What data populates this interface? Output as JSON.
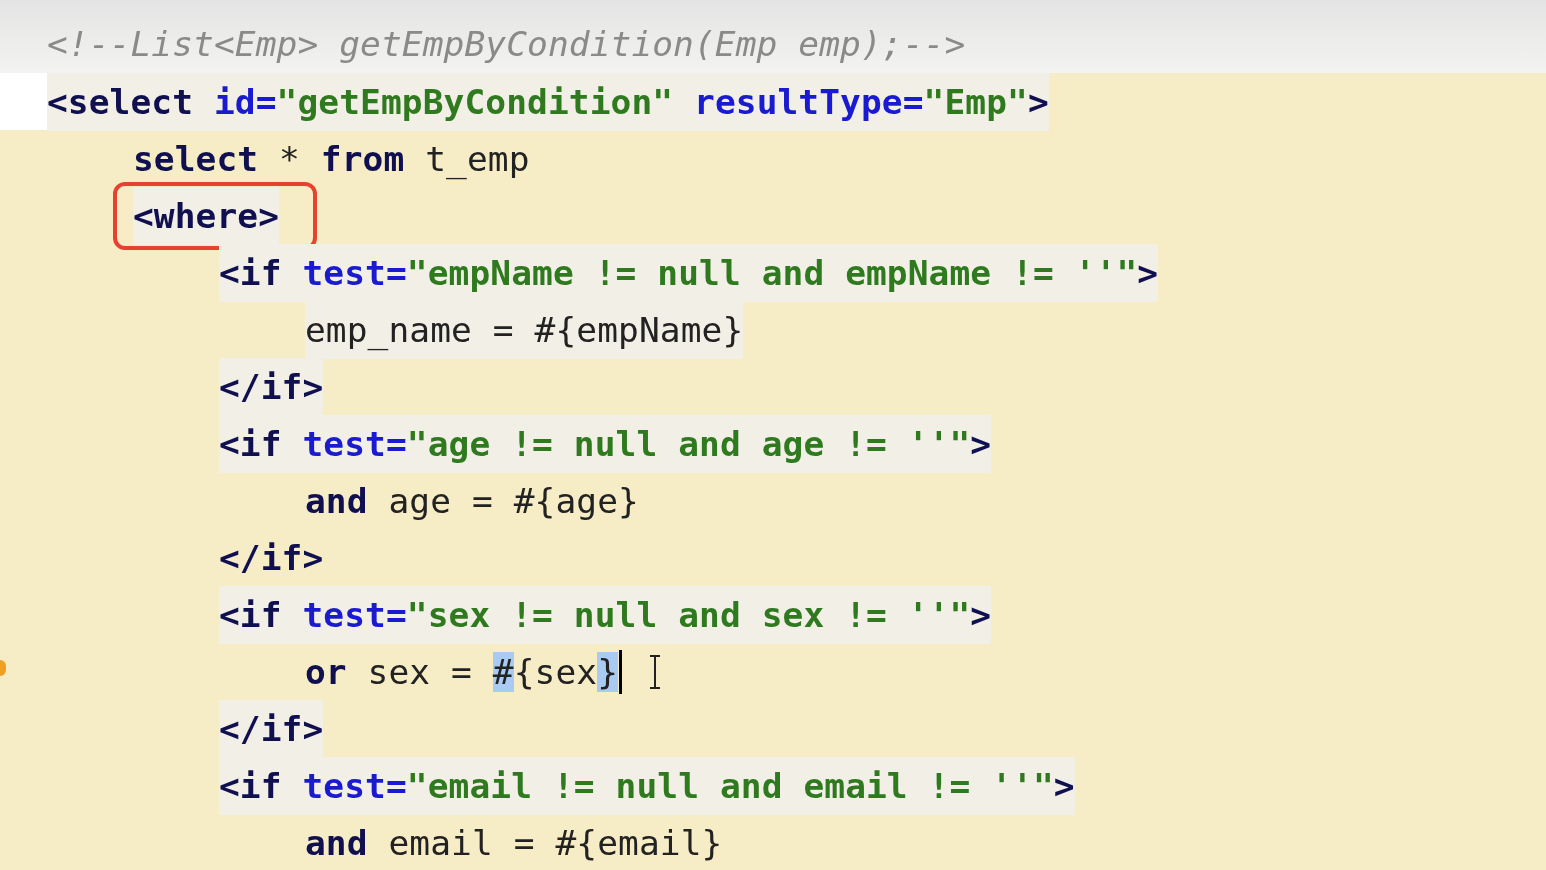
{
  "editor": {
    "lines": [
      {
        "tokens": [
          {
            "kind": "comment",
            "text": "<!--List<Emp> getEmpByCondition(Emp emp);-->"
          }
        ]
      },
      {
        "band": true,
        "tokens": [
          {
            "kind": "tag",
            "text": "<select "
          },
          {
            "kind": "attr",
            "text": "id="
          },
          {
            "kind": "string",
            "text": "\"getEmpByCondition\" "
          },
          {
            "kind": "attr",
            "text": "resultType="
          },
          {
            "kind": "string",
            "text": "\"Emp\""
          },
          {
            "kind": "tag",
            "text": ">"
          }
        ],
        "children": [
          {
            "band": false,
            "tokens": [
              {
                "kind": "keyword",
                "text": "select"
              },
              {
                "kind": "plain",
                "text": " * "
              },
              {
                "kind": "keyword",
                "text": "from"
              },
              {
                "kind": "plain",
                "text": " t_emp"
              }
            ]
          },
          {
            "band": true,
            "boxed": true,
            "tokens": [
              {
                "kind": "tag",
                "text": "<where>"
              }
            ],
            "children": [
              {
                "band": true,
                "tokens": [
                  {
                    "kind": "tag",
                    "text": "<if "
                  },
                  {
                    "kind": "attr",
                    "text": "test="
                  },
                  {
                    "kind": "string",
                    "text": "\"empName != null and empName != ''\""
                  },
                  {
                    "kind": "tag",
                    "text": ">"
                  }
                ],
                "children": [
                  {
                    "band": true,
                    "tokens": [
                      {
                        "kind": "plain",
                        "text": "emp_name = #{empName}"
                      }
                    ]
                  }
                ]
              },
              {
                "band": true,
                "tokens": [
                  {
                    "kind": "tag",
                    "text": "</if>"
                  }
                ]
              },
              {
                "band": true,
                "tokens": [
                  {
                    "kind": "tag",
                    "text": "<if "
                  },
                  {
                    "kind": "attr",
                    "text": "test="
                  },
                  {
                    "kind": "string",
                    "text": "\"age != null and age != ''\""
                  },
                  {
                    "kind": "tag",
                    "text": ">"
                  }
                ],
                "children": [
                  {
                    "band": false,
                    "tokens": [
                      {
                        "kind": "keyword",
                        "text": "and"
                      },
                      {
                        "kind": "plain",
                        "text": " age = #{age}"
                      }
                    ]
                  }
                ]
              },
              {
                "band": false,
                "tokens": [
                  {
                    "kind": "tag",
                    "text": "</if>"
                  }
                ]
              },
              {
                "band": true,
                "tokens": [
                  {
                    "kind": "tag",
                    "text": "<if "
                  },
                  {
                    "kind": "attr",
                    "text": "test="
                  },
                  {
                    "kind": "string",
                    "text": "\"sex != null and sex != ''\""
                  },
                  {
                    "kind": "tag",
                    "text": ">"
                  }
                ],
                "children": [
                  {
                    "band": false,
                    "caret": true,
                    "tokens": [
                      {
                        "kind": "keyword",
                        "text": "or"
                      },
                      {
                        "kind": "plain",
                        "text": " sex = "
                      },
                      {
                        "kind": "plain",
                        "text": "#",
                        "matched": true
                      },
                      {
                        "kind": "plain",
                        "text": "{sex"
                      },
                      {
                        "kind": "plain",
                        "text": "}",
                        "matched": true
                      }
                    ]
                  }
                ]
              },
              {
                "band": true,
                "tokens": [
                  {
                    "kind": "tag",
                    "text": "</if>"
                  }
                ]
              },
              {
                "band": true,
                "tokens": [
                  {
                    "kind": "tag",
                    "text": "<if "
                  },
                  {
                    "kind": "attr",
                    "text": "test="
                  },
                  {
                    "kind": "string",
                    "text": "\"email != null and email != ''\""
                  },
                  {
                    "kind": "tag",
                    "text": ">"
                  }
                ],
                "children": [
                  {
                    "band": false,
                    "tokens": [
                      {
                        "kind": "keyword",
                        "text": "and"
                      },
                      {
                        "kind": "plain",
                        "text": " email = #{email}"
                      }
                    ]
                  }
                ]
              }
            ]
          }
        ]
      }
    ]
  }
}
